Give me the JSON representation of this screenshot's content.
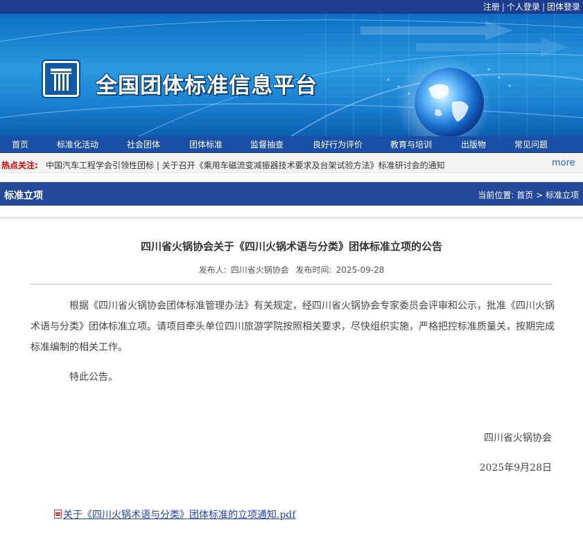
{
  "top_links": [
    "注册",
    "个人登录",
    "团体登录"
  ],
  "site": {
    "title": "全国团体标准信息平台"
  },
  "nav": [
    "首页",
    "标准化活动",
    "社会团体",
    "团体标准",
    "监督抽查",
    "良好行为评价",
    "教育与培训",
    "出版物",
    "常见问题"
  ],
  "hot": {
    "label": "热点关注:",
    "text": "中国汽车工程学会引领性团标 | 关于召开《乘用车磁流变减振器技术要求及台架试验方法》标准研讨会的通知",
    "more": "more"
  },
  "section": {
    "title": "标准立项",
    "breadcrumb_prefix": "当前位置:",
    "breadcrumb_home": "首页",
    "breadcrumb_sep": ">",
    "breadcrumb_current": "标准立项"
  },
  "article": {
    "title": "四川省火锅协会关于《四川火锅术语与分类》团体标准立项的公告",
    "publisher_label": "发布人:",
    "publisher": "四川省火锅协会",
    "time_label": "发布时间:",
    "time": "2025-09-28",
    "paragraph1": "根据《四川省火锅协会团体标准管理办法》有关规定，经四川省火锅协会专家委员会评审和公示，批准《四川火锅术语与分类》团体标准立项。请项目牵头单位四川旅游学院按照相关要求，尽快组织实施，严格把控标准质量关，按期完成标准编制的相关工作。",
    "paragraph2": "特此公告。",
    "signature_org": "四川省火锅协会",
    "signature_date": "2025年9月28日",
    "attachment": "关于《四川火锅术语与分类》团体标准的立项通知.pdf"
  },
  "colors": {
    "topbar": "#1e3d8f",
    "nav": "#1b4fa6",
    "section_header": "#24489a",
    "hot_label": "#d40000",
    "link": "#1f3fbf"
  }
}
